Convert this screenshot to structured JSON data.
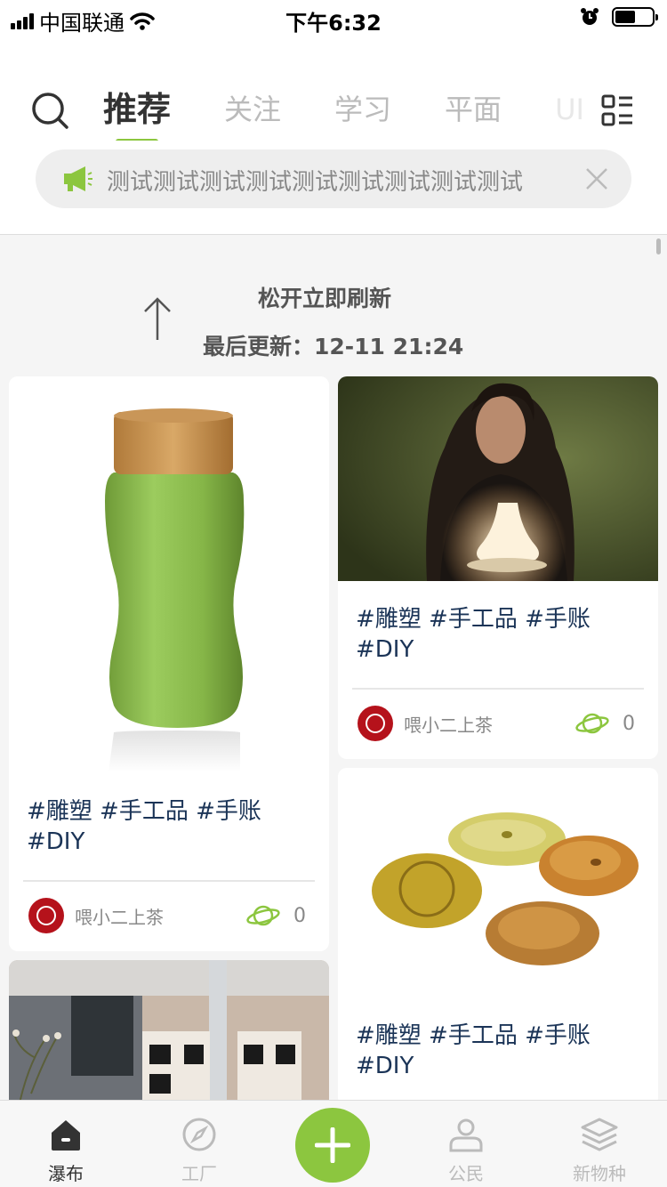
{
  "status_bar": {
    "carrier": "中国联通",
    "time": "下午6:32"
  },
  "header": {
    "tabs": [
      "推荐",
      "关注",
      "学习",
      "平面",
      "UI"
    ],
    "active_tab": "推荐",
    "notice_text": "测试测试测试测试测试测试测试测试测试"
  },
  "refresh": {
    "message": "松开立即刷新",
    "last_updated": "最后更新：12-11 21:24"
  },
  "cards": [
    {
      "tags": "#雕塑 #手工品 #手账 #DIY",
      "author": "喂小二上茶",
      "likes": "0",
      "image": "green-ceramic-bottle"
    },
    {
      "tags": "#雕塑 #手工品 #手账 #DIY",
      "author": "喂小二上茶",
      "likes": "0",
      "image": "woman-holding-lamp"
    },
    {
      "tags": "#雕塑 #手工品 #手账 #DIY",
      "author": "",
      "likes": "",
      "image": "yellow-clay-pieces"
    },
    {
      "tags": "",
      "author": "",
      "likes": "",
      "image": "interior-room"
    }
  ],
  "bottom_nav": {
    "items": [
      "瀑布",
      "工厂",
      "公民",
      "新物种"
    ],
    "active": "瀑布"
  },
  "colors": {
    "accent": "#8cc63f",
    "tag_text": "#1b3457",
    "avatar": "#b5121b"
  }
}
